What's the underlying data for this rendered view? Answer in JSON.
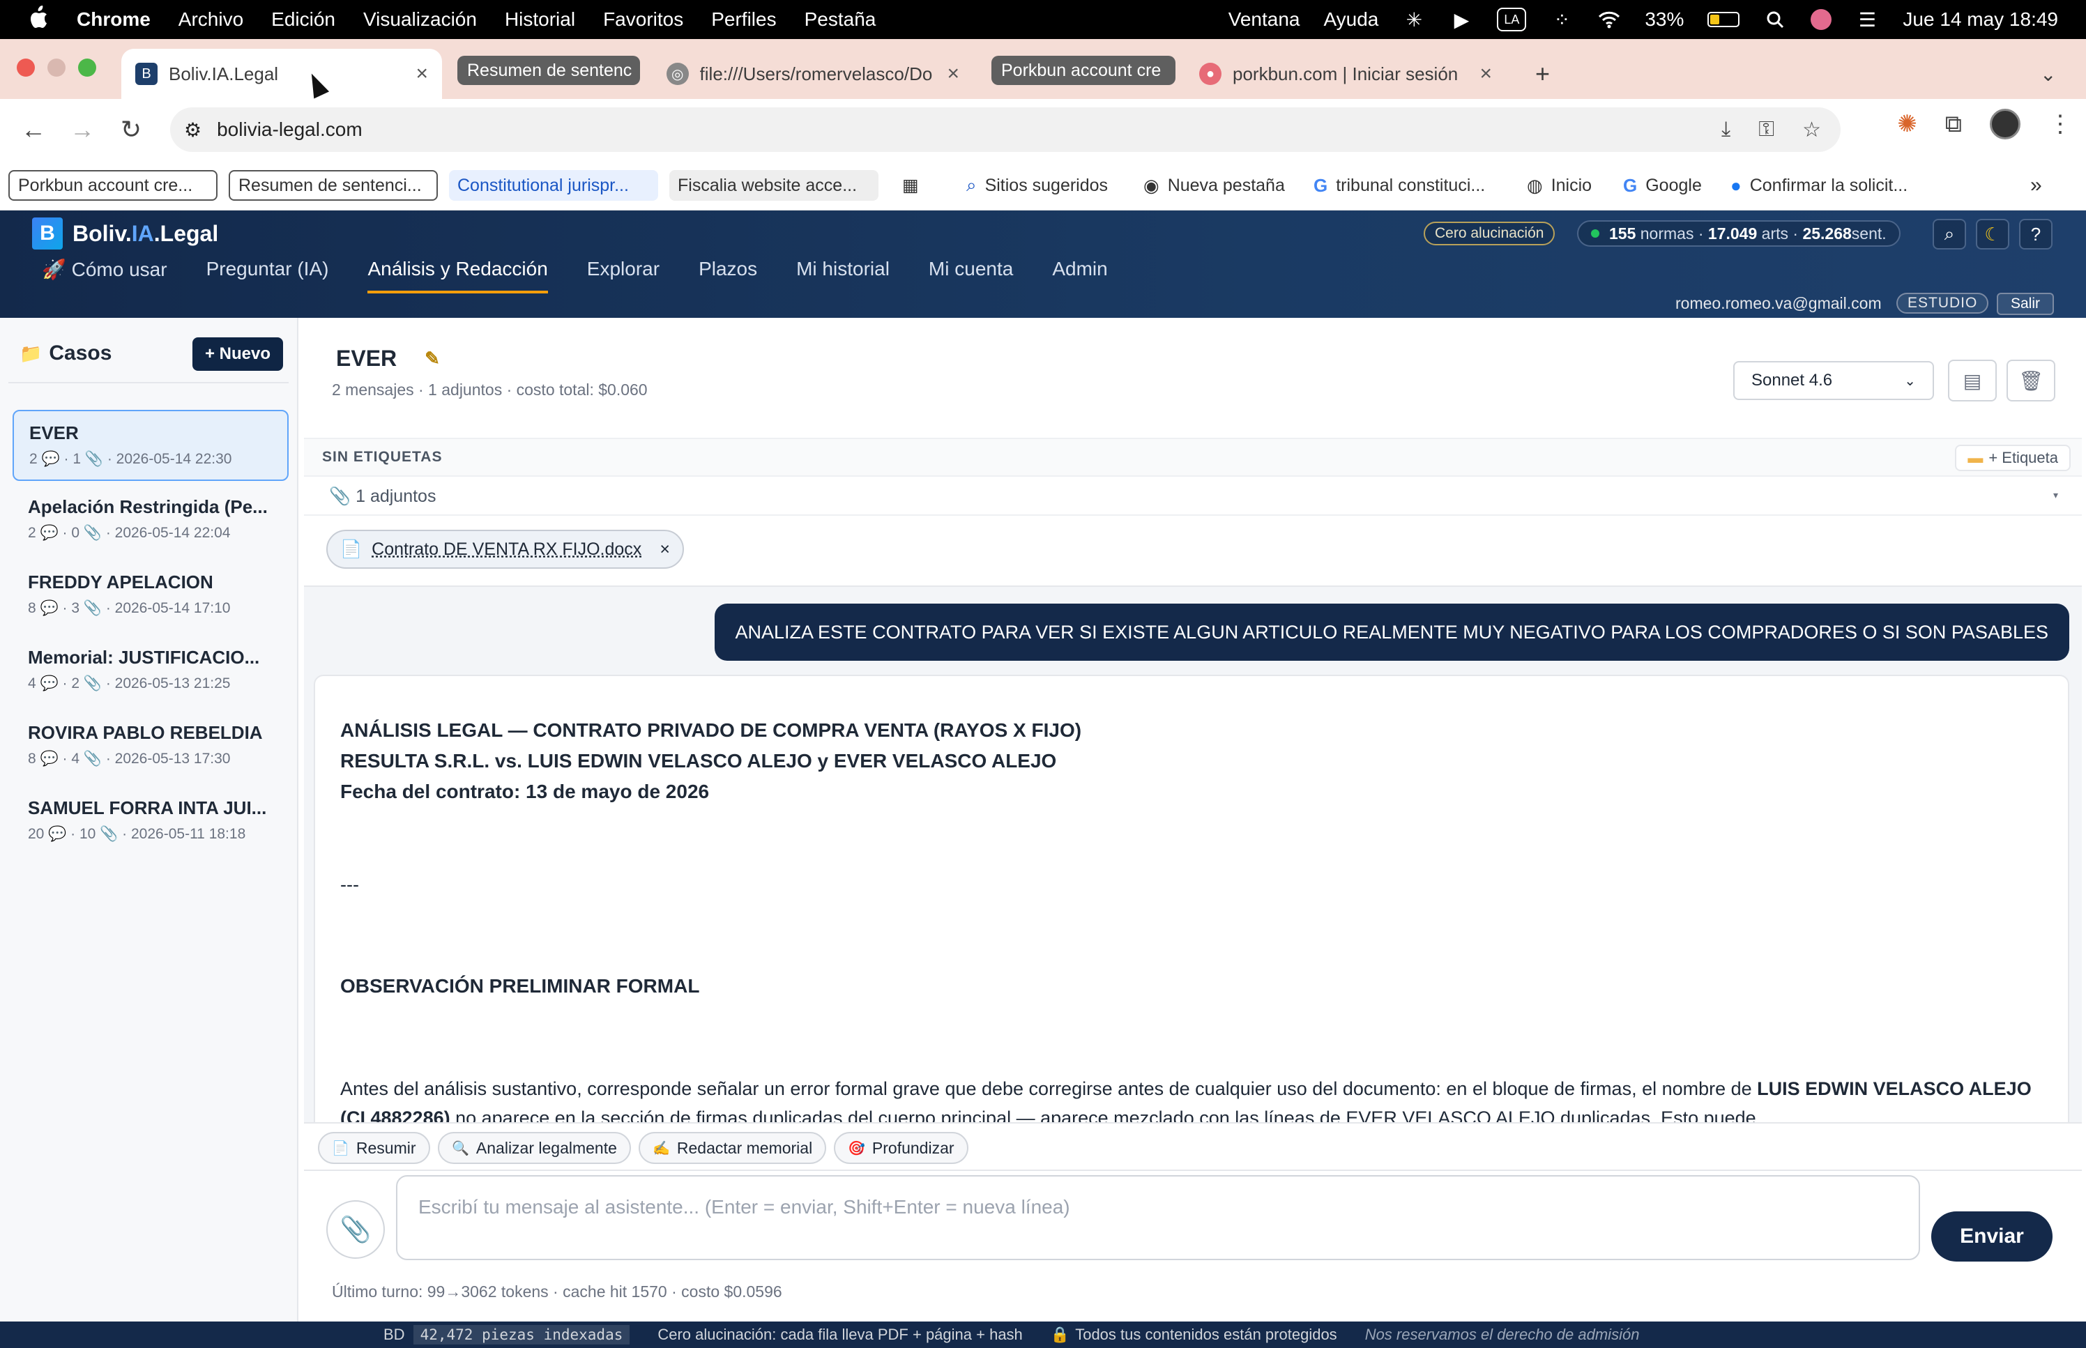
{
  "macos": {
    "app_name": "Chrome",
    "menus": [
      "Archivo",
      "Edición",
      "Visualización",
      "Historial",
      "Favoritos",
      "Perfiles",
      "Pestaña",
      "Ventana",
      "Ayuda"
    ],
    "input_source": "LA",
    "battery": "33%",
    "clock": "Jue 14 may  18:49"
  },
  "tabs": {
    "active_title": "Boliv.IA.Legal",
    "group1_label": "Resumen de sentenc",
    "tab2_title": "file:///Users/romervelasco/Do",
    "group2_label": "Porkbun account cre",
    "tab3_title": "porkbun.com | Iniciar sesión",
    "new_tab": "+"
  },
  "address_bar": {
    "url": "bolivia-legal.com"
  },
  "bookmarks": [
    "Porkbun account cre...",
    "Resumen de sentenci...",
    "Constitutional jurispr...",
    "Fiscalia website acce...",
    "Sitios sugeridos",
    "Nueva pestaña",
    "tribunal constituci...",
    "Inicio",
    "Google",
    "Confirmar la solicit..."
  ],
  "app": {
    "brand_pre": "Boliv.",
    "brand_ia": "IA",
    "brand_post": ".Legal",
    "cero_badge": "Cero alucinación",
    "stats": {
      "normas": "155",
      "normas_label": " normas · ",
      "arts": "17.049",
      "arts_label": " arts · ",
      "sent": "25.268",
      "sent_label": " sent."
    },
    "nav": [
      "🚀 Cómo usar",
      "Preguntar (IA)",
      "Análisis y Redacción",
      "Explorar",
      "Plazos",
      "Mi historial",
      "Mi cuenta",
      "Admin"
    ],
    "user_email": "romeo.romeo.va@gmail.com",
    "plan": "ESTUDIO",
    "logout": "Salir"
  },
  "sidebar": {
    "title": "Casos",
    "new_button": "+ Nuevo",
    "cases": [
      {
        "title": "EVER",
        "meta": "2 💬 · 1 📎 · 2026-05-14 22:30"
      },
      {
        "title": "Apelación Restringida (Pe...",
        "meta": "2 💬 · 0 📎 · 2026-05-14 22:04"
      },
      {
        "title": "FREDDY APELACION",
        "meta": "8 💬 · 3 📎 · 2026-05-14 17:10"
      },
      {
        "title": "Memorial: JUSTIFICACIO...",
        "meta": "4 💬 · 2 📎 · 2026-05-13 21:25"
      },
      {
        "title": "ROVIRA PABLO REBELDIA",
        "meta": "8 💬 · 4 📎 · 2026-05-13 17:30"
      },
      {
        "title": "SAMUEL FORRA INTA JUI...",
        "meta": "20 💬 · 10 📎 · 2026-05-11 18:18"
      }
    ]
  },
  "main": {
    "case_title": "EVER",
    "case_subtitle": "2 mensajes · 1 adjuntos · costo total: $0.060",
    "model": "Sonnet 4.6",
    "tags_label": "SIN ETIQUETAS",
    "add_tag": "+ Etiqueta",
    "attachments_label": "1 adjuntos",
    "attachments_toggle": "▾",
    "file_name": "Contrato DE VENTA RX FIJO.docx",
    "user_message": "ANALIZA ESTE CONTRATO PARA VER SI EXISTE ALGUN ARTICULO REALMENTE MUY NEGATIVO PARA LOS COMPRADORES O SI SON PASABLES",
    "reply": {
      "line1": "ANÁLISIS LEGAL — CONTRATO PRIVADO DE COMPRA VENTA (RAYOS X FIJO)",
      "line2": "RESULTA S.R.L. vs. LUIS EDWIN VELASCO ALEJO y EVER VELASCO ALEJO",
      "line3": "Fecha del contrato: 13 de mayo de 2026",
      "separator": "---",
      "section": "OBSERVACIÓN PRELIMINAR FORMAL",
      "para_start": "Antes del análisis sustantivo, corresponde señalar un error formal grave que debe corregirse antes de cualquier uso del documento: en el bloque de firmas, el nombre de ",
      "para_bold": "LUIS EDWIN VELASCO ALEJO (CI 4882286)",
      "para_end": " no aparece en la sección de firmas duplicadas del cuerpo principal — aparece mezclado con las líneas de EVER VELASCO ALEJO duplicadas. Esto puede"
    },
    "quick_actions": [
      "Resumir",
      "Analizar legalmente",
      "Redactar memorial",
      "Profundizar"
    ],
    "input_placeholder": "Escribí tu mensaje al asistente... (Enter = enviar, Shift+Enter = nueva línea)",
    "send": "Enviar",
    "usage": "Último turno: 99→3062 tokens · cache hit 1570 · costo $0.0596"
  },
  "footer": {
    "db_label": "BD",
    "db_count": "42,472 piezas indexadas",
    "cero": "Cero alucinación: cada fila lleva PDF + página + hash",
    "secure": "Todos tus contenidos están protegidos",
    "rights": "Nos reservamos el derecho de admisión"
  },
  "colors": {
    "navy": "#14294a",
    "accent": "#f59e0b",
    "active_case": "#e6f0fb"
  }
}
